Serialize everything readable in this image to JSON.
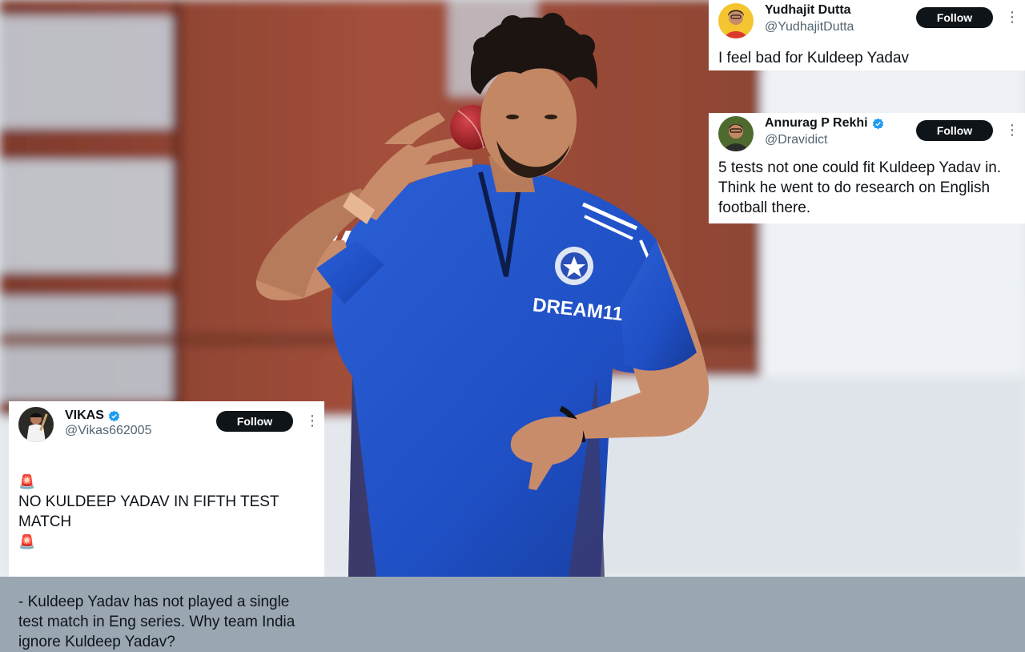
{
  "photo": {
    "jersey_brand": "DREAM11",
    "subject": "cricketer-tossing-ball"
  },
  "tweets": [
    {
      "name": "Yudhajit Dutta",
      "handle": "@YudhajitDutta",
      "verified": false,
      "follow_label": "Follow",
      "text": "I feel bad for Kuldeep Yadav"
    },
    {
      "name": "Annurag P Rekhi",
      "handle": "@Dravidict",
      "verified": true,
      "follow_label": "Follow",
      "text": "5 tests not one could fit Kuldeep Yadav in. Think he went to do research on English football there."
    },
    {
      "name": "VIKAS",
      "handle": "@Vikas662005",
      "verified": true,
      "follow_label": "Follow",
      "text_line1": "NO KULDEEP YADAV IN FIFTH TEST MATCH",
      "text_line2": "- Kuldeep Yadav has not played a single test match in Eng series. Why team India ignore Kuldeep Yadav?"
    }
  ],
  "colors": {
    "jersey_blue": "#1f4fc4",
    "follow_bg": "#0f1419",
    "verified_blue": "#1d9bf0",
    "handle_grey": "#536471"
  },
  "icons": {
    "verified": "verified-badge-icon",
    "more": "more-options-icon",
    "siren": "siren-icon"
  }
}
